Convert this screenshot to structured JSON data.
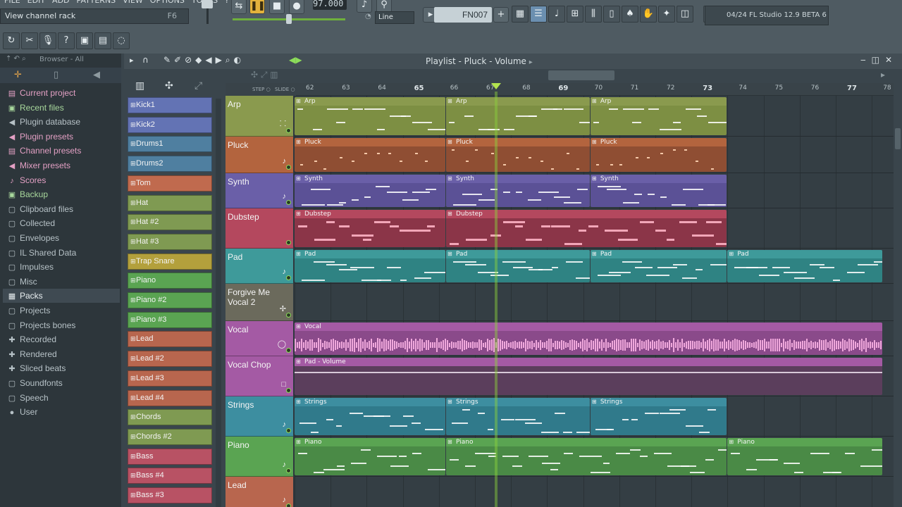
{
  "menu": [
    "FILE",
    "EDIT",
    "ADD",
    "PATTERNS",
    "VIEW",
    "OPTIONS",
    "TOOLS",
    "?"
  ],
  "hint": {
    "text": "View channel rack",
    "key": "F6"
  },
  "tempo": "97.000",
  "pattern": "FN007",
  "snap": "Line",
  "hint_panel": "04/24  FL Studio 12.9 BETA 6",
  "browser": {
    "header": "Browser - All",
    "items": [
      {
        "label": "Current project",
        "icon": "▤",
        "style": "hot"
      },
      {
        "label": "Recent files",
        "icon": "▣",
        "style": "grn"
      },
      {
        "label": "Plugin database",
        "icon": "◀",
        "style": "norm"
      },
      {
        "label": "Plugin presets",
        "icon": "◀",
        "style": "hot"
      },
      {
        "label": "Channel presets",
        "icon": "▤",
        "style": "hot"
      },
      {
        "label": "Mixer presets",
        "icon": "◀",
        "style": "hot"
      },
      {
        "label": "Scores",
        "icon": "♪",
        "style": "hot"
      },
      {
        "label": "Backup",
        "icon": "▣",
        "style": "grn"
      },
      {
        "label": "Clipboard files",
        "icon": "▢",
        "style": "norm"
      },
      {
        "label": "Collected",
        "icon": "▢",
        "style": "norm"
      },
      {
        "label": "Envelopes",
        "icon": "▢",
        "style": "norm"
      },
      {
        "label": "IL Shared Data",
        "icon": "▢",
        "style": "norm"
      },
      {
        "label": "Impulses",
        "icon": "▢",
        "style": "norm"
      },
      {
        "label": "Misc",
        "icon": "▢",
        "style": "norm"
      },
      {
        "label": "Packs",
        "icon": "▦",
        "style": "sel"
      },
      {
        "label": "Projects",
        "icon": "▢",
        "style": "norm"
      },
      {
        "label": "Projects bones",
        "icon": "▢",
        "style": "norm"
      },
      {
        "label": "Recorded",
        "icon": "✚",
        "style": "norm"
      },
      {
        "label": "Rendered",
        "icon": "✚",
        "style": "norm"
      },
      {
        "label": "Sliced beats",
        "icon": "✚",
        "style": "norm"
      },
      {
        "label": "Soundfonts",
        "icon": "▢",
        "style": "norm"
      },
      {
        "label": "Speech",
        "icon": "▢",
        "style": "norm"
      },
      {
        "label": "User",
        "icon": "●",
        "style": "norm"
      }
    ]
  },
  "channels": [
    {
      "name": "Kick1",
      "color": "#6373b4"
    },
    {
      "name": "Kick2",
      "color": "#6373b4"
    },
    {
      "name": "Drums1",
      "color": "#4f7fa0"
    },
    {
      "name": "Drums2",
      "color": "#4f7fa0"
    },
    {
      "name": "Tom",
      "color": "#c06a4e"
    },
    {
      "name": "Hat",
      "color": "#7f9a52"
    },
    {
      "name": "Hat #2",
      "color": "#7f9a52"
    },
    {
      "name": "Hat #3",
      "color": "#7f9a52"
    },
    {
      "name": "Trap Snare",
      "color": "#b3a03c"
    },
    {
      "name": "Piano",
      "color": "#5aa452"
    },
    {
      "name": "Piano #2",
      "color": "#5aa452"
    },
    {
      "name": "Piano #3",
      "color": "#5aa452"
    },
    {
      "name": "Lead",
      "color": "#b8664e"
    },
    {
      "name": "Lead #2",
      "color": "#b8664e"
    },
    {
      "name": "Lead #3",
      "color": "#b8664e"
    },
    {
      "name": "Lead #4",
      "color": "#b8664e"
    },
    {
      "name": "Chords",
      "color": "#7f9a52"
    },
    {
      "name": "Chords #2",
      "color": "#7f9a52"
    },
    {
      "name": "Bass",
      "color": "#b85264"
    },
    {
      "name": "Bass #4",
      "color": "#b85264"
    },
    {
      "name": "Bass #3",
      "color": "#b85264"
    }
  ],
  "playlist_title": "Playlist - Pluck - Volume",
  "timeline": [
    "62",
    "63",
    "64",
    "65",
    "66",
    "67",
    "68",
    "69",
    "70",
    "71",
    "72",
    "73",
    "74",
    "75",
    "76",
    "77",
    "78"
  ],
  "playhead_bar": 67.2,
  "tracks": [
    {
      "name": "Arp",
      "icon": "⸬",
      "color": "#8a9a4e",
      "clipcolor": "#7d8f43",
      "clips": [
        {
          "label": "Arp",
          "from": 62,
          "to": 66.2
        },
        {
          "label": "Arp",
          "from": 66.2,
          "to": 70.2
        },
        {
          "label": "Arp",
          "from": 70.2,
          "to": 74
        }
      ]
    },
    {
      "name": "Pluck",
      "icon": "♪",
      "color": "#b3643e",
      "clipcolor": "#8f4e33",
      "clips": [
        {
          "label": "Pluck",
          "from": 62,
          "to": 66.2
        },
        {
          "label": "Pluck",
          "from": 66.2,
          "to": 70.2
        },
        {
          "label": "Pluck",
          "from": 70.2,
          "to": 74
        }
      ]
    },
    {
      "name": "Synth",
      "icon": "♪",
      "color": "#6a5fa8",
      "clipcolor": "#5b5196",
      "clips": [
        {
          "label": "Synth",
          "from": 62,
          "to": 66.2
        },
        {
          "label": "Synth",
          "from": 66.2,
          "to": 70.2
        },
        {
          "label": "Synth",
          "from": 70.2,
          "to": 74
        }
      ]
    },
    {
      "name": "Dubstep",
      "icon": "",
      "color": "#b4485e",
      "clipcolor": "#8b3548",
      "clips": [
        {
          "label": "Dubstep",
          "from": 62,
          "to": 66.2
        },
        {
          "label": "Dubstep",
          "from": 66.2,
          "to": 74
        }
      ]
    },
    {
      "name": "Pad",
      "icon": "♪",
      "color": "#3e9a9a",
      "clipcolor": "#2f8383",
      "clips": [
        {
          "label": "Pad",
          "from": 62,
          "to": 66.2
        },
        {
          "label": "Pad",
          "from": 66.2,
          "to": 70.2
        },
        {
          "label": "Pad",
          "from": 70.2,
          "to": 74
        },
        {
          "label": "Pad",
          "from": 74,
          "to": 78.3
        }
      ]
    },
    {
      "name": "Forgive Me Vocal 2",
      "icon": "✢",
      "color": "#6b6a5c",
      "clipcolor": "#555",
      "clips": []
    },
    {
      "name": "Vocal",
      "icon": "◯",
      "color": "#a45aa4",
      "clipcolor": "#8a4a8a",
      "clips": [
        {
          "label": "Vocal",
          "from": 62,
          "to": 78.3
        }
      ]
    },
    {
      "name": "Vocal Chop",
      "icon": "□",
      "color": "#a45aa4",
      "clipcolor": "#5b3e5c",
      "clips": [
        {
          "label": "Pad - Volume",
          "from": 62,
          "to": 78.3
        }
      ]
    },
    {
      "name": "Strings",
      "icon": "♪",
      "color": "#3d8ea0",
      "clipcolor": "#307a8b",
      "clips": [
        {
          "label": "Strings",
          "from": 62,
          "to": 66.2
        },
        {
          "label": "Strings",
          "from": 66.2,
          "to": 70.2
        },
        {
          "label": "Strings",
          "from": 70.2,
          "to": 74
        }
      ]
    },
    {
      "name": "Piano",
      "icon": "♪",
      "color": "#5aa452",
      "clipcolor": "#4a8a46",
      "clips": [
        {
          "label": "Piano",
          "from": 62,
          "to": 66.2
        },
        {
          "label": "Piano",
          "from": 66.2,
          "to": 74
        },
        {
          "label": "Piano",
          "from": 74,
          "to": 78.3
        }
      ]
    },
    {
      "name": "Lead",
      "icon": "♪",
      "color": "#b8664e",
      "clipcolor": "#8f4e33",
      "clips": []
    }
  ]
}
